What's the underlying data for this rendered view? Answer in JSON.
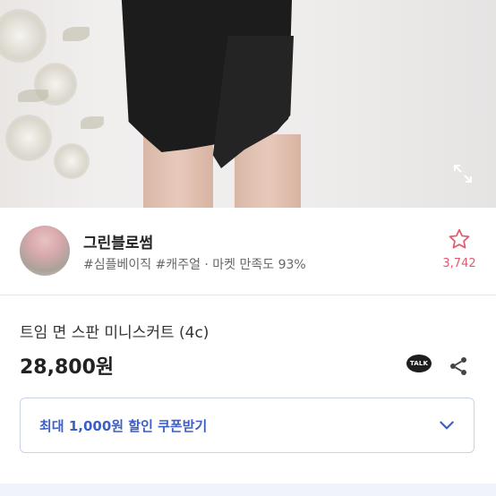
{
  "seller": {
    "name": "그린블로썸",
    "tags": "#심플베이직 #캐주얼 · 마켓 만족도 93%",
    "favorite_count": "3,742"
  },
  "product": {
    "title": "트임 면 스판 미니스커트 (4c)",
    "price": "28,800원"
  },
  "actions": {
    "talk_label": "TALK"
  },
  "coupon": {
    "label": "최대 1,000원 할인 쿠폰받기"
  },
  "colors": {
    "accent": "#3d5ec4",
    "favorite": "#e05b6c",
    "coupon_border": "#c9d3ea"
  },
  "icons": [
    "expand-icon",
    "star-icon",
    "kakao-talk-icon",
    "share-icon",
    "chevron-down-icon"
  ]
}
